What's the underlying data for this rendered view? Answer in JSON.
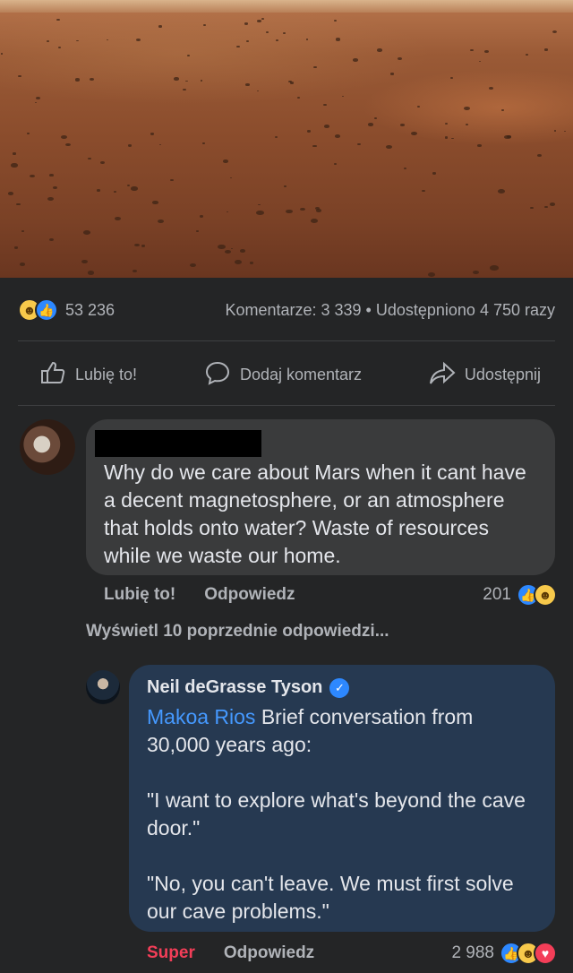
{
  "post": {
    "reactions": {
      "icons": [
        "haha",
        "like"
      ],
      "count": "53 236"
    },
    "stats_right": "Komentarze: 3 339 • Udostępniono 4 750 razy",
    "actions": {
      "like_label": "Lubię to!",
      "comment_label": "Dodaj komentarz",
      "share_label": "Udostępnij"
    }
  },
  "comment": {
    "text": "Why do we care about Mars when it cant have a decent magnetosphere, or an atmosphere that holds onto water? Waste of resources while we waste our home.",
    "like_label": "Lubię to!",
    "reply_label": "Odpowiedz",
    "reaction_count": "201",
    "reaction_icons": [
      "like",
      "haha"
    ]
  },
  "view_more_label": "Wyświetl 10 poprzednie odpowiedzi...",
  "reply": {
    "author": "Neil deGrasse Tyson",
    "mention": "Makoa Rios",
    "line1_rest": " Brief conversation from 30,000 years ago:",
    "para2": "\"I want to explore what's beyond the cave door.\"",
    "para3": "\"No, you can't leave. We must first solve our cave problems.\"",
    "reaction_label": "Super",
    "reply_label": "Odpowiedz",
    "reaction_count": "2 988",
    "reaction_icons": [
      "like",
      "haha",
      "love"
    ]
  },
  "colors": {
    "background": "#242526",
    "bubble": "#3a3b3c",
    "reply_bubble": "#263951",
    "accent": "#2d88ff",
    "super": "#f33e58"
  }
}
